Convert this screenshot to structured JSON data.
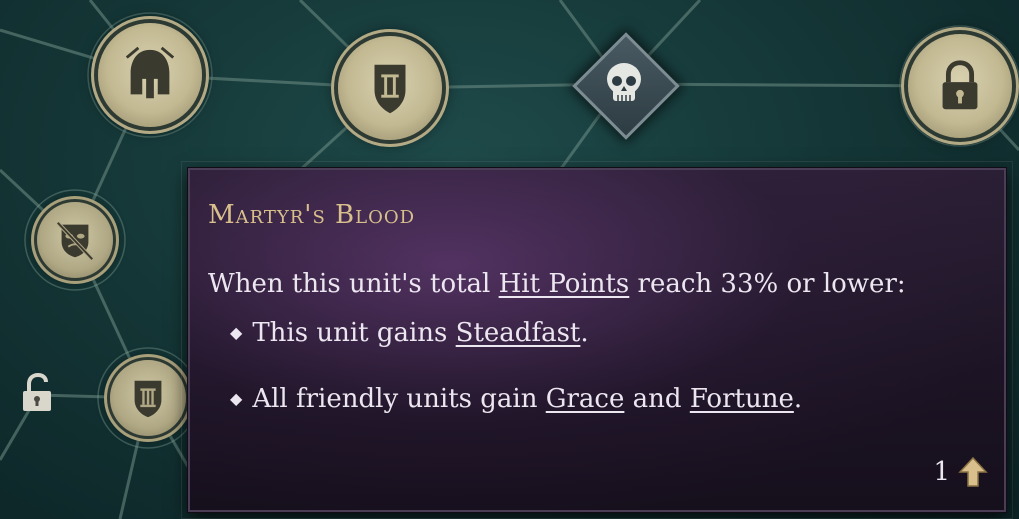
{
  "tooltip": {
    "title": "Martyr's Blood",
    "intro": {
      "before": "When this unit's total ",
      "keyword": "Hit Points",
      "after": " reach 33% or lower:"
    },
    "bullets": [
      {
        "before": "This unit gains ",
        "k1": "Steadfast",
        "mid": ".",
        "k2": "",
        "after": ""
      },
      {
        "before": "All friendly units gain ",
        "k1": "Grace",
        "mid": " and ",
        "k2": "Fortune",
        "after": "."
      }
    ],
    "bullet_glyph": "◆",
    "cost": {
      "value": "1",
      "icon": "upgrade-arrow-icon"
    }
  },
  "skill_tree": {
    "nodes": [
      {
        "icon": "spartan-helmet-icon"
      },
      {
        "icon": "shield-tier-ii-icon",
        "label": "II"
      },
      {
        "icon": "skull-icon"
      },
      {
        "icon": "padlock-icon"
      },
      {
        "icon": "crossed-out-mask-icon"
      },
      {
        "icon": "shield-tier-iii-icon",
        "label": "III"
      },
      {
        "icon": "unlocked-padlock-icon"
      }
    ]
  },
  "colors": {
    "title": "#d9bf8c",
    "text": "#ece6f0",
    "node_gold": "#c2b992",
    "background": "#153737",
    "tooltip_bg": "#1c1424"
  }
}
